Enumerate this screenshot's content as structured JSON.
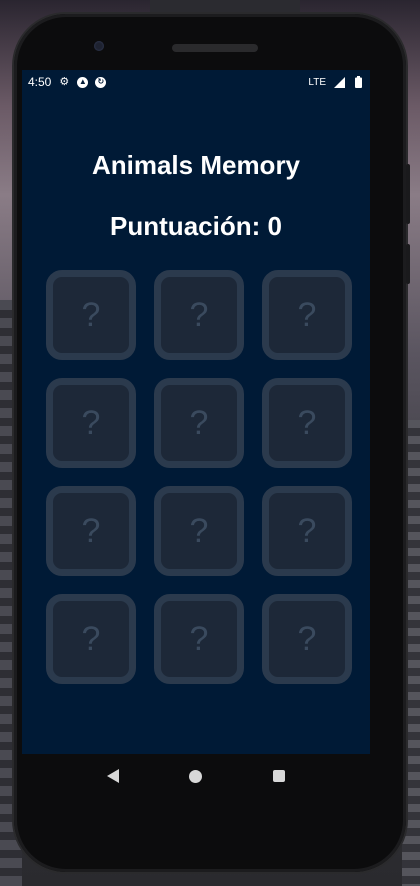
{
  "status_bar": {
    "time": "4:50",
    "network": "LTE",
    "icons": [
      "gear-icon",
      "a-circle-icon",
      "sync-circle-icon",
      "signal-icon",
      "battery-icon"
    ]
  },
  "app": {
    "title": "Animals Memory",
    "score_label": "Puntuación: 0"
  },
  "cards": [
    {
      "symbol": "?"
    },
    {
      "symbol": "?"
    },
    {
      "symbol": "?"
    },
    {
      "symbol": "?"
    },
    {
      "symbol": "?"
    },
    {
      "symbol": "?"
    },
    {
      "symbol": "?"
    },
    {
      "symbol": "?"
    },
    {
      "symbol": "?"
    },
    {
      "symbol": "?"
    },
    {
      "symbol": "?"
    },
    {
      "symbol": "?"
    }
  ],
  "nav": {
    "icons": [
      "back-icon",
      "home-icon",
      "recents-icon"
    ]
  },
  "colors": {
    "screen_background": "#001a36",
    "card_border": "#2b3a4d",
    "card_fill": "#1d2838",
    "text": "#ffffff"
  }
}
